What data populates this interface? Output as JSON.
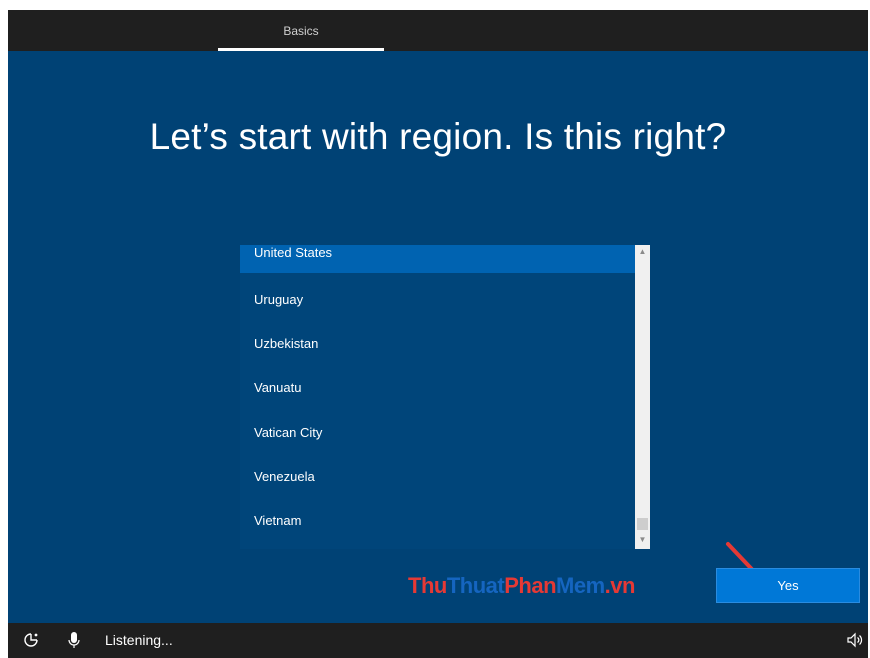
{
  "header": {
    "tab_label": "Basics"
  },
  "main": {
    "title": "Let’s start with region. Is this right?",
    "regions": [
      {
        "label": "United States",
        "selected": true
      },
      {
        "label": "Uruguay",
        "selected": false
      },
      {
        "label": "Uzbekistan",
        "selected": false
      },
      {
        "label": "Vanuatu",
        "selected": false
      },
      {
        "label": "Vatican City",
        "selected": false
      },
      {
        "label": "Venezuela",
        "selected": false
      },
      {
        "label": "Vietnam",
        "selected": false
      }
    ],
    "yes_label": "Yes"
  },
  "watermark": {
    "part1": "Thu",
    "part2": "Thuat",
    "part3": "Phan",
    "part4": "Mem",
    "part5": ".vn"
  },
  "footer": {
    "status": "Listening..."
  },
  "icons": {
    "ease_of_access": "ease-of-access-icon",
    "microphone": "microphone-icon",
    "volume": "volume-icon",
    "arrow": "red-arrow-annotation"
  },
  "colors": {
    "background": "#004275",
    "selected": "#0063b1",
    "accent": "#0078d7",
    "chrome": "#1f1f1f"
  }
}
